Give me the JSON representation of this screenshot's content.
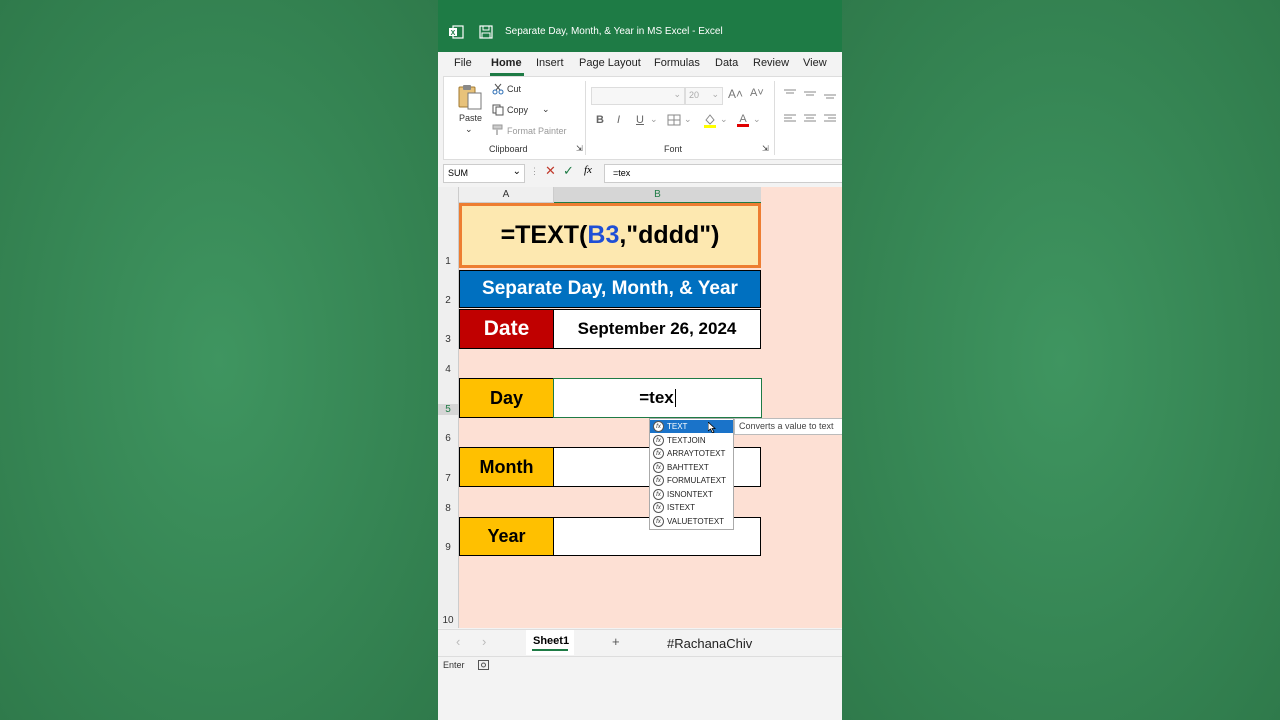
{
  "window": {
    "title": "Separate Day, Month, & Year in MS Excel  -  Excel"
  },
  "menu": {
    "items": [
      "File",
      "Home",
      "Insert",
      "Page Layout",
      "Formulas",
      "Data",
      "Review",
      "View"
    ],
    "active": "Home"
  },
  "ribbon": {
    "paste": "Paste",
    "cut": "Cut",
    "copy": "Copy",
    "format_painter": "Format Painter",
    "clipboard": "Clipboard",
    "font": "Font",
    "font_size": "20",
    "bold": "B",
    "italic": "I",
    "underline": "U"
  },
  "formula_bar": {
    "name_box": "SUM",
    "formula": "=tex",
    "fx": "fx"
  },
  "columns": [
    "A",
    "B"
  ],
  "rows": [
    "1",
    "2",
    "3",
    "4",
    "5",
    "6",
    "7",
    "8",
    "9",
    "10"
  ],
  "cells": {
    "banner_prefix": "=TEXT(",
    "banner_ref": "B3",
    "banner_suffix": ",\"dddd\")",
    "header": "Separate Day, Month, & Year",
    "date_label": "Date",
    "date_value": "September 26, 2024",
    "day_label": "Day",
    "day_input": "=tex",
    "month_label": "Month",
    "year_label": "Year"
  },
  "autocomplete": {
    "items": [
      "TEXT",
      "TEXTJOIN",
      "ARRAYTOTEXT",
      "BAHTTEXT",
      "FORMULATEXT",
      "ISNONTEXT",
      "ISTEXT",
      "VALUETOTEXT"
    ],
    "selected": "TEXT",
    "tooltip": "Converts a value to text"
  },
  "sheet_tabs": {
    "active": "Sheet1",
    "add": "+",
    "watermark": "#RachanaChiv"
  },
  "status": {
    "mode": "Enter"
  },
  "colors": {
    "excel_green": "#1e7b45",
    "header_blue": "#0070c0",
    "date_red": "#c00000",
    "label_yellow": "#ffc000",
    "banner_bg": "#fde8b0",
    "banner_border": "#ed7d31",
    "sheet_bg": "#fde0d4"
  }
}
